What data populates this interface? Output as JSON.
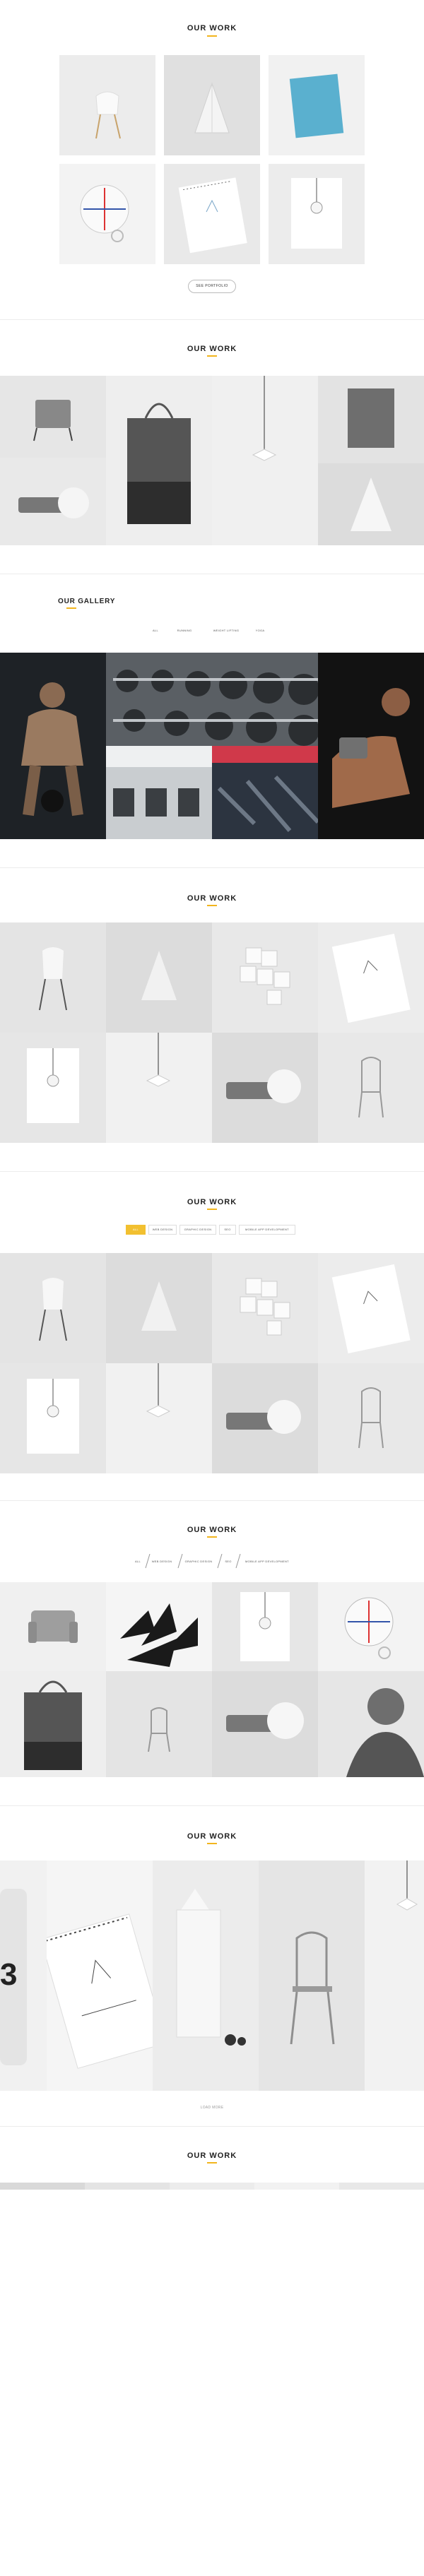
{
  "section1": {
    "title": "OUR WORK",
    "button": "SEE PORTFOLIO"
  },
  "section2": {
    "title": "OUR WORK"
  },
  "section3": {
    "title": "OUR GALLERY",
    "filters": [
      "ALL",
      "RUNNING",
      "WEIGHT LIFTING",
      "YOGA"
    ]
  },
  "section4": {
    "title": "OUR WORK"
  },
  "section5": {
    "title": "OUR WORK",
    "filters": [
      "ALL",
      "WEB DESIGN",
      "GRAPHIC DESIGN",
      "SEO",
      "MOBILE APP DEVELOPMENT"
    ]
  },
  "section6": {
    "title": "OUR WORK",
    "filters": [
      "ALL",
      "WEB DESIGN",
      "GRAPHIC DESIGN",
      "SEO",
      "MOBILE APP DEVELOPMENT"
    ]
  },
  "section7": {
    "title": "OUR WORK",
    "pager": "LOAD MORE"
  },
  "section8": {
    "title": "OUR WORK"
  },
  "colors": {
    "accent": "#f2b51d",
    "divider": "#ececec"
  }
}
